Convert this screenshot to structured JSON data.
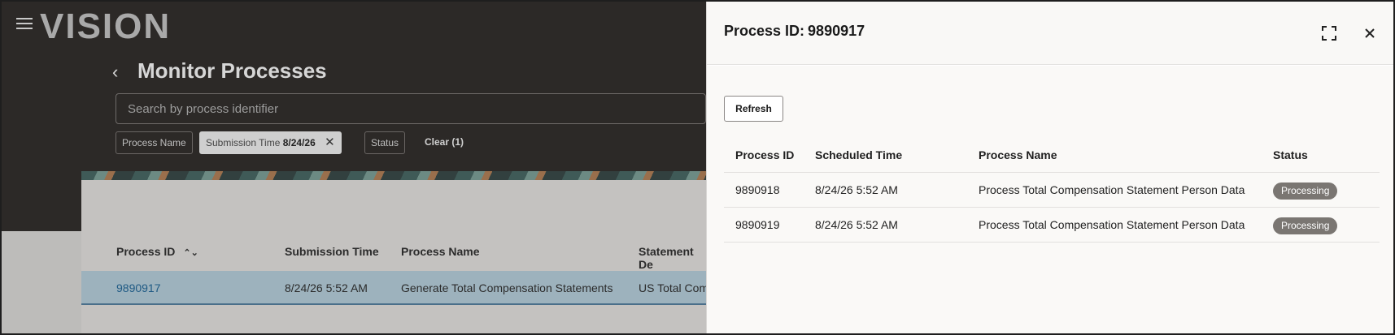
{
  "app": {
    "logo": "VISION",
    "page_title": "Monitor Processes",
    "search": {
      "placeholder": "Search by process identifier",
      "value": ""
    },
    "filters": {
      "process_name": "Process Name",
      "submission_time_label": "Submission Time",
      "submission_time_value": "8/24/26",
      "status": "Status",
      "clear": "Clear (1)"
    },
    "table": {
      "headers": [
        "Process ID",
        "Submission Time",
        "Process Name",
        "Statement De"
      ],
      "rows": [
        {
          "process_id": "9890917",
          "submission_time": "8/24/26 5:52 AM",
          "process_name": "Generate Total Compensation Statements",
          "statement": "US Total Com"
        }
      ]
    }
  },
  "drawer": {
    "title_prefix": "Process ID:",
    "title_id": "9890917",
    "refresh_label": "Refresh",
    "table": {
      "headers": [
        "Process ID",
        "Scheduled Time",
        "Process Name",
        "Status"
      ],
      "rows": [
        {
          "process_id": "9890918",
          "scheduled_time": "8/24/26 5:52 AM",
          "process_name": "Process Total Compensation Statement Person Data",
          "status": "Processing"
        },
        {
          "process_id": "9890919",
          "scheduled_time": "8/24/26 5:52 AM",
          "process_name": "Process Total Compensation Statement Person Data",
          "status": "Processing"
        }
      ]
    }
  }
}
